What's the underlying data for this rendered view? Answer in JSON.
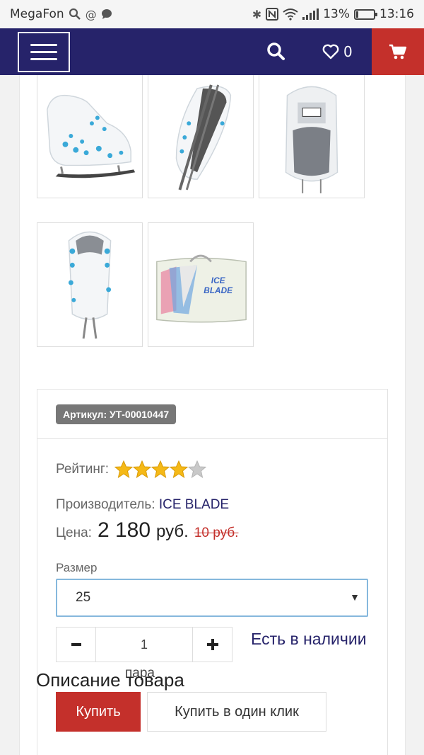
{
  "status_bar": {
    "carrier": "MegaFon",
    "battery": "13%",
    "battery_level": 0.13,
    "time": "13:16"
  },
  "nav": {
    "favorites_count": "0"
  },
  "gallery": {
    "images": [
      {
        "name": "skate-side-view"
      },
      {
        "name": "skate-blade-view"
      },
      {
        "name": "skate-top-view"
      },
      {
        "name": "skate-back-view"
      },
      {
        "name": "skate-bag"
      }
    ],
    "bag_logo_line1": "ICE",
    "bag_logo_line2": "BLADE"
  },
  "product": {
    "sku": "Артикул: УТ-00010447",
    "rating_label": "Рейтинг:",
    "rating": 4,
    "rating_max": 5,
    "maker_label": "Производитель:",
    "maker": "ICE BLADE",
    "price_label": "Цена:",
    "price": "2 180",
    "price_currency": "руб.",
    "old_price": "10 руб.",
    "size_label": "Размер",
    "size_value": "25",
    "quantity": "1",
    "unit": "пара",
    "stock_status": "Есть в наличии",
    "buy_label": "Купить",
    "one_click_label": "Купить в один клик",
    "description_title": "Описание товара"
  },
  "colors": {
    "nav_bg": "#26236a",
    "accent_red": "#c4302b",
    "star_fill": "#f5b917"
  }
}
